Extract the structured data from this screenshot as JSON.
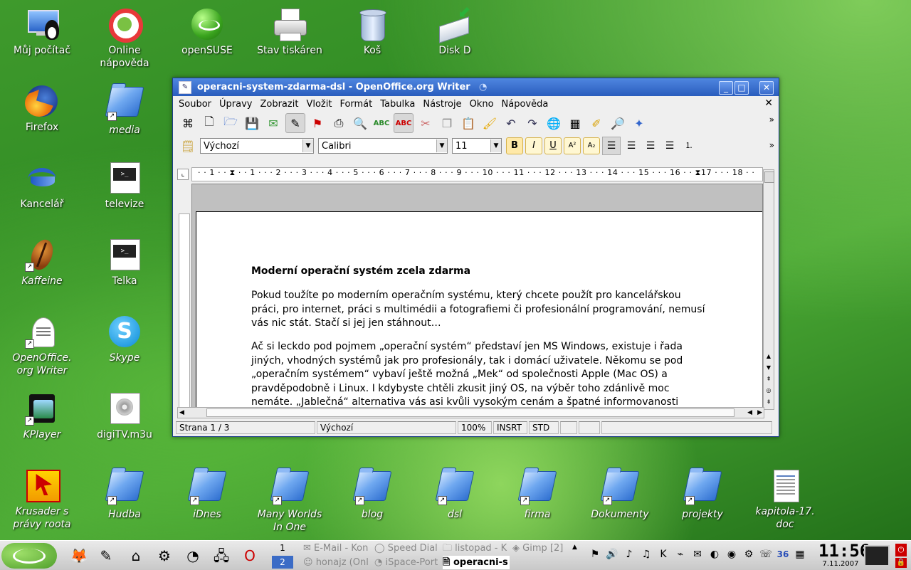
{
  "desktop": {
    "icons": [
      {
        "label": "Můj počítač",
        "italic": false,
        "icon": "computer-icon"
      },
      {
        "label": "Online\nnápověda",
        "italic": false,
        "icon": "lifebuoy-icon"
      },
      {
        "label": "openSUSE",
        "italic": false,
        "icon": "opensuse-icon"
      },
      {
        "label": "Stav tiskáren",
        "italic": false,
        "icon": "printer-icon"
      },
      {
        "label": "Koš",
        "italic": false,
        "icon": "trash-icon"
      },
      {
        "label": "Disk D",
        "italic": false,
        "icon": "disk-icon"
      },
      {
        "label": "Firefox",
        "italic": false,
        "icon": "firefox-icon"
      },
      {
        "label": "media",
        "italic": true,
        "icon": "folder-icon"
      },
      {
        "label": "Kancelář",
        "italic": false,
        "icon": "openoffice-icon"
      },
      {
        "label": "televize",
        "italic": false,
        "icon": "terminal-icon"
      },
      {
        "label": "Kaffeine",
        "italic": true,
        "icon": "kaffeine-icon"
      },
      {
        "label": "Telka",
        "italic": false,
        "icon": "terminal-icon"
      },
      {
        "label": "OpenOffice.\norg Writer",
        "italic": true,
        "icon": "writer-icon"
      },
      {
        "label": "Skype",
        "italic": true,
        "icon": "skype-icon"
      },
      {
        "label": "KPlayer",
        "italic": true,
        "icon": "kplayer-icon"
      },
      {
        "label": "digiTV.m3u",
        "italic": false,
        "icon": "audio-file-icon"
      },
      {
        "label": "Krusader s\nprávy roota",
        "italic": true,
        "icon": "krusader-icon"
      },
      {
        "label": "Hudba",
        "italic": true,
        "icon": "folder-icon"
      },
      {
        "label": "iDnes",
        "italic": true,
        "icon": "folder-icon"
      },
      {
        "label": "Many Worlds\nIn One",
        "italic": true,
        "icon": "folder-icon"
      },
      {
        "label": "blog",
        "italic": true,
        "icon": "folder-icon"
      },
      {
        "label": "dsl",
        "italic": true,
        "icon": "folder-icon"
      },
      {
        "label": "firma",
        "italic": true,
        "icon": "folder-icon"
      },
      {
        "label": "Dokumenty",
        "italic": true,
        "icon": "folder-icon"
      },
      {
        "label": "projekty",
        "italic": true,
        "icon": "folder-icon"
      },
      {
        "label": "kapitola-17.\ndoc",
        "italic": true,
        "icon": "document-icon"
      }
    ]
  },
  "window": {
    "title": "operacni-system-zdarma-dsl - OpenOffice.org Writer",
    "menu": [
      "Soubor",
      "Úpravy",
      "Zobrazit",
      "Vložit",
      "Formát",
      "Tabulka",
      "Nástroje",
      "Okno",
      "Nápověda"
    ],
    "format": {
      "style": "Výchozí",
      "font": "Calibri",
      "size": "11"
    },
    "ruler": "· · 1 · · ⧗ · · 1 · · · 2 · · · 3 · · · 4 · · · 5 · · · 6 · · · 7 · · · 8 · · · 9 · · · 10 · · · 11 · · · 12 · · · 13 · · · 14 · · · 15 · · · 16 · · ⧗17 · · · 18 · ·",
    "document": {
      "heading": "Moderní operační systém zcela zdarma",
      "p1": "Pokud toužíte po moderním operačním systému, který chcete použít pro kancelářskou práci, pro internet, práci s multimédii a fotografiemi či profesionální programování, nemusí vás nic stát. Stačí si jej jen stáhnout…",
      "p2": "Ač si leckdo pod pojmem „operační systém“ představí jen MS Windows, existuje i řada jiných, vhodných systémů jak pro profesionály, tak i domácí uživatele. Někomu se pod „operačním systémem“ vybaví ještě možná „Mek“ od společnosti Apple (Mac OS) a pravděpodobně i Linux. I kdybyste chtěli zkusit jiný OS, na výběr toho zdánlivě moc nemáte. „Jablečná“ alternativa vás asi kvůli vysokým cenám a špatné informovanosti"
    },
    "status": {
      "page": "Strana 1 / 3",
      "style": "Výchozí",
      "zoom": "100%",
      "insert": "INSRT",
      "mode": "STD"
    }
  },
  "taskbar": {
    "pager": [
      "1",
      "2"
    ],
    "tasks": [
      {
        "label": "E-Mail - Kon",
        "active": false
      },
      {
        "label": "Speed Dial",
        "active": false
      },
      {
        "label": "listopad - K",
        "active": false
      },
      {
        "label": "Gimp [2]",
        "active": false
      },
      {
        "label": "honajz (Onl",
        "active": false
      },
      {
        "label": "iSpace-Port",
        "active": false
      },
      {
        "label": "operacni-s",
        "active": true
      }
    ],
    "tray_number": "36",
    "clock_time": "11:56",
    "clock_date": "7.11.2007"
  }
}
